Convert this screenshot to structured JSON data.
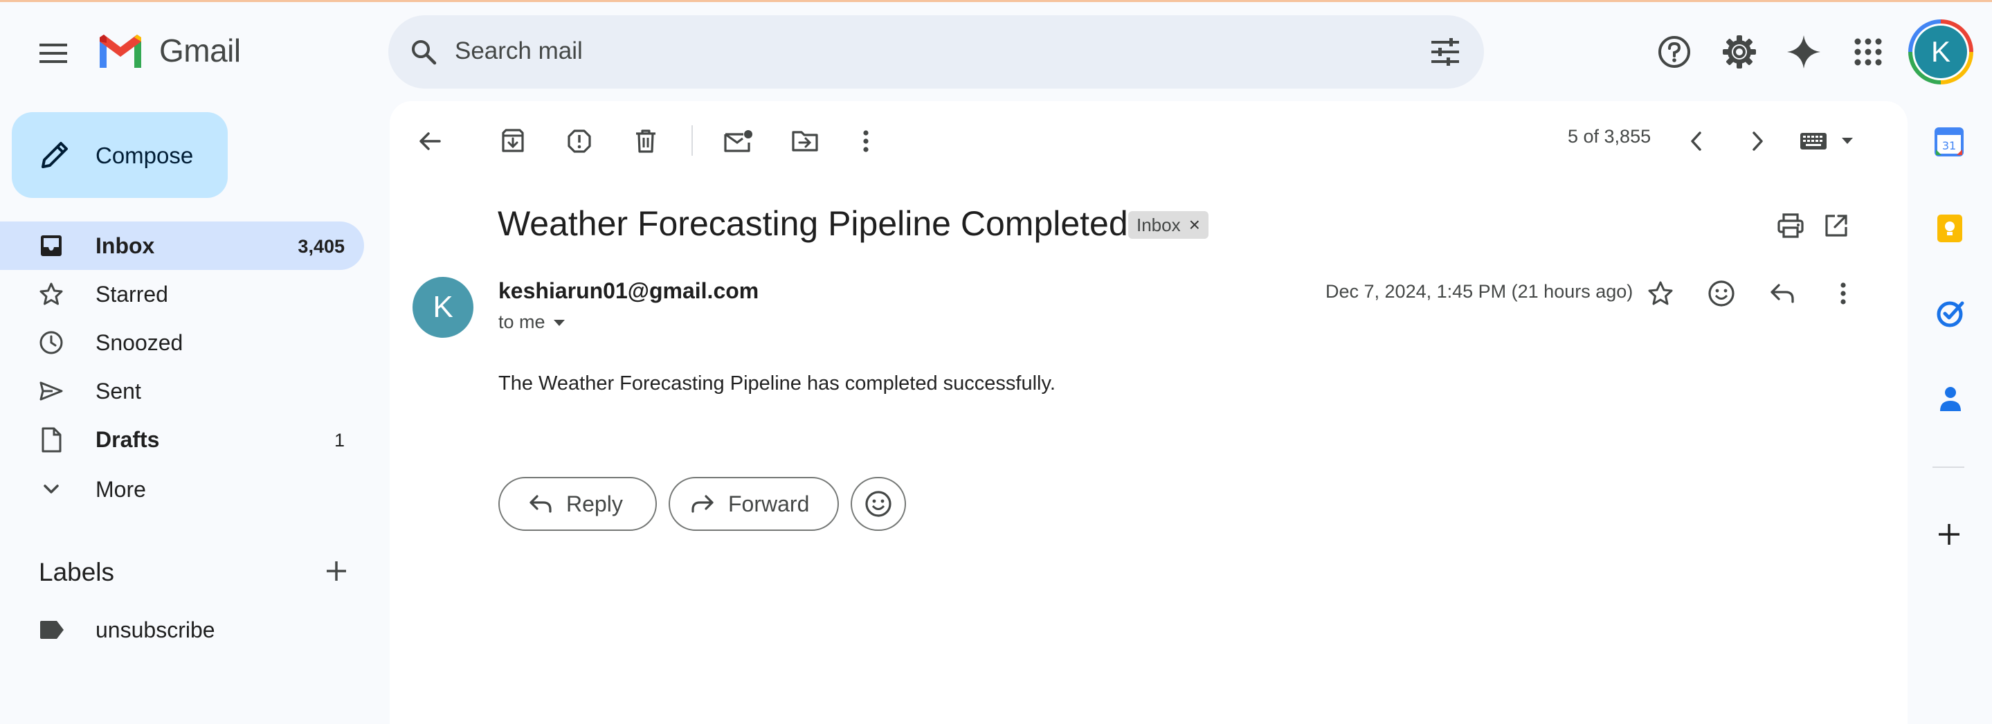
{
  "app": {
    "name": "Gmail",
    "avatar_letter": "K"
  },
  "icons": {
    "menu": "menu-icon",
    "search": "search-icon",
    "filters": "tune-icon",
    "help": "help-icon",
    "settings": "gear-icon",
    "gemini": "sparkle-icon",
    "apps": "apps-grid-icon"
  },
  "search": {
    "placeholder": "Search mail"
  },
  "compose": {
    "label": "Compose"
  },
  "sidebar": {
    "items": [
      {
        "label": "Inbox",
        "count": "3,405",
        "icon": "inbox-icon"
      },
      {
        "label": "Starred",
        "count": "",
        "icon": "star-icon"
      },
      {
        "label": "Snoozed",
        "count": "",
        "icon": "clock-icon"
      },
      {
        "label": "Sent",
        "count": "",
        "icon": "send-icon"
      },
      {
        "label": "Drafts",
        "count": "1",
        "icon": "draft-icon"
      },
      {
        "label": "More",
        "count": "",
        "icon": "chevron-down-icon"
      }
    ],
    "labels_title": "Labels",
    "labels": [
      {
        "label": "unsubscribe",
        "icon": "label-icon"
      }
    ]
  },
  "toolbar": {
    "pager": "5 of 3,855"
  },
  "email": {
    "subject": "Weather Forecasting Pipeline Completed",
    "label_chip": "Inbox",
    "label_chip_remove": "×",
    "sender_initial": "K",
    "sender": "keshiarun01@gmail.com",
    "to": "to me",
    "date": "Dec 7, 2024, 1:45 PM (21 hours ago)",
    "body": "The Weather Forecasting Pipeline has completed successfully."
  },
  "actions": {
    "reply": "Reply",
    "forward": "Forward"
  },
  "right_rail": {
    "calendar_day": "31"
  },
  "colors": {
    "background": "#f8fafd",
    "compose": "#c2e7ff",
    "active_nav": "#d3e3fd",
    "search": "#e9eef6",
    "avatar": "#4a9aad"
  }
}
